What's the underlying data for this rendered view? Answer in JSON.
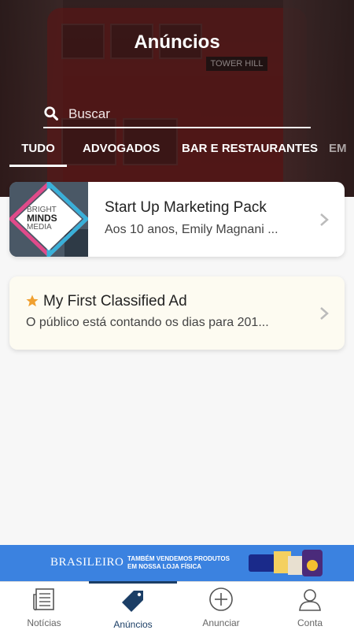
{
  "header": {
    "title": "Anúncios",
    "sign_text": "TOWER HILL"
  },
  "search": {
    "placeholder": "Buscar"
  },
  "tabs": [
    {
      "label": "TUDO",
      "active": true
    },
    {
      "label": "ADVOGADOS",
      "active": false
    },
    {
      "label": "BAR E RESTAURANTES",
      "active": false
    },
    {
      "label": "EM",
      "active": false
    }
  ],
  "listings": [
    {
      "title": "Start Up Marketing Pack",
      "subtitle": "Aos 10 anos, Emily Magnani ...",
      "thumb_lines": [
        "BRIGHT",
        "MINDS",
        "MEDIA"
      ],
      "featured": false
    },
    {
      "title": "My First Classified Ad",
      "subtitle": "O público está contando os dias para 201...",
      "featured": true,
      "star_color": "#f0a030"
    }
  ],
  "ad": {
    "brand": "BRASILEIRO",
    "line1": "TAMBÉM VENDEMOS PRODUTOS",
    "line2": "EM NOSSA LOJA FÍSICA",
    "color": "#3b82e0"
  },
  "nav": [
    {
      "label": "Notícias",
      "icon": "newspaper-icon",
      "active": false
    },
    {
      "label": "Anúncios",
      "icon": "tag-icon",
      "active": true
    },
    {
      "label": "Anunciar",
      "icon": "plus-circle-icon",
      "active": false
    },
    {
      "label": "Conta",
      "icon": "user-icon",
      "active": false
    }
  ],
  "colors": {
    "nav_active": "#1b3e66",
    "header_tint": "#5c1e1e"
  }
}
